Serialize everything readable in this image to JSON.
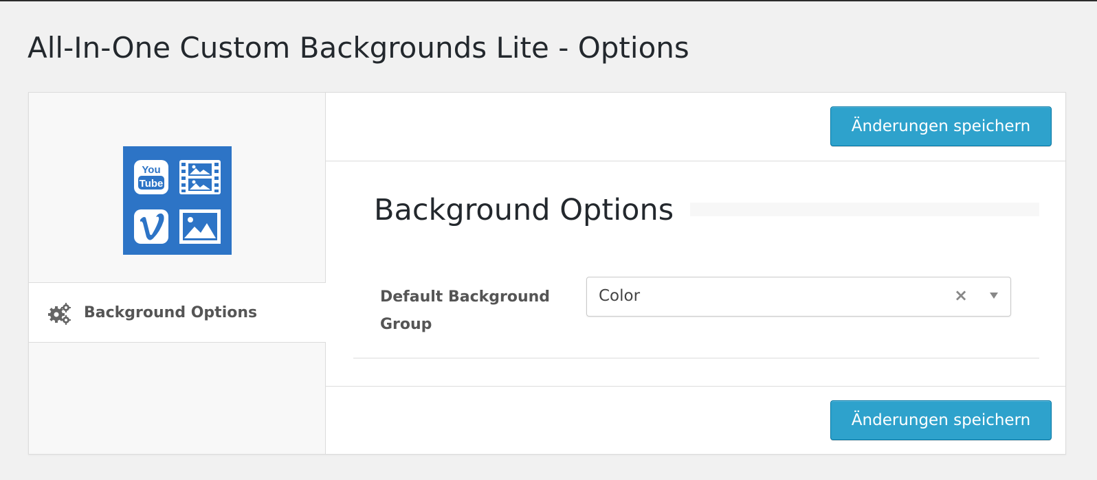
{
  "page": {
    "title": "All-In-One Custom Backgrounds Lite - Options"
  },
  "sidebar": {
    "logo_icons": [
      "youtube-icon",
      "film-icon",
      "vimeo-icon",
      "image-icon"
    ],
    "logo_text": "You Tube",
    "logo_color": "#2d74c6",
    "items": [
      {
        "label": "Background Options",
        "icon": "gears-icon",
        "active": true
      }
    ]
  },
  "toolbar": {
    "save_label": "Änderungen speichern"
  },
  "section": {
    "title": "Background Options"
  },
  "fields": {
    "default_background_group": {
      "label": "Default Background Group",
      "value": "Color",
      "clear_glyph": "×"
    }
  },
  "colors": {
    "accent": "#2ea2cc",
    "accent_border": "#0074a2",
    "background": "#f1f1f1"
  }
}
